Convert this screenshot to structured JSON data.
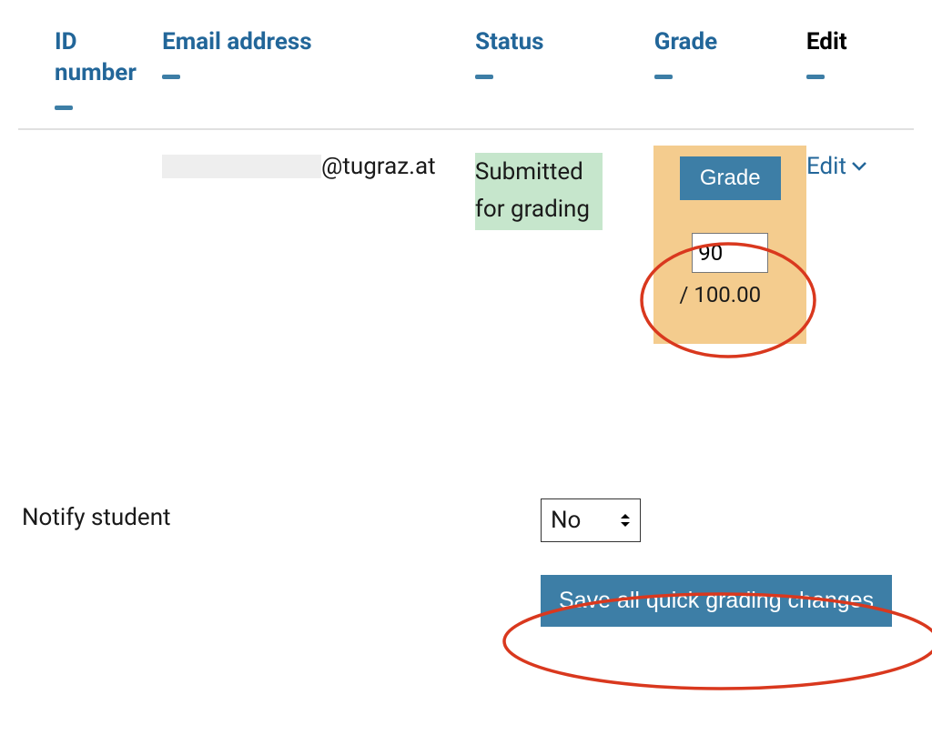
{
  "columns": {
    "id_number": "ID number",
    "email": "Email address",
    "status": "Status",
    "grade": "Grade",
    "edit": "Edit"
  },
  "row": {
    "email_domain": "@tugraz.at",
    "status_text": "Submitted for grading",
    "grade_button": "Grade",
    "grade_value": "90",
    "grade_max": "/ 100.00",
    "edit_link": "Edit"
  },
  "notify": {
    "label": "Notify student",
    "selected": "No"
  },
  "save_button": "Save all quick grading changes",
  "colors": {
    "accent": "#3d7ea6",
    "link": "#226699",
    "highlight": "#f4cc8e",
    "status_bg": "#c6e6cc",
    "annotation": "#d9381e"
  }
}
